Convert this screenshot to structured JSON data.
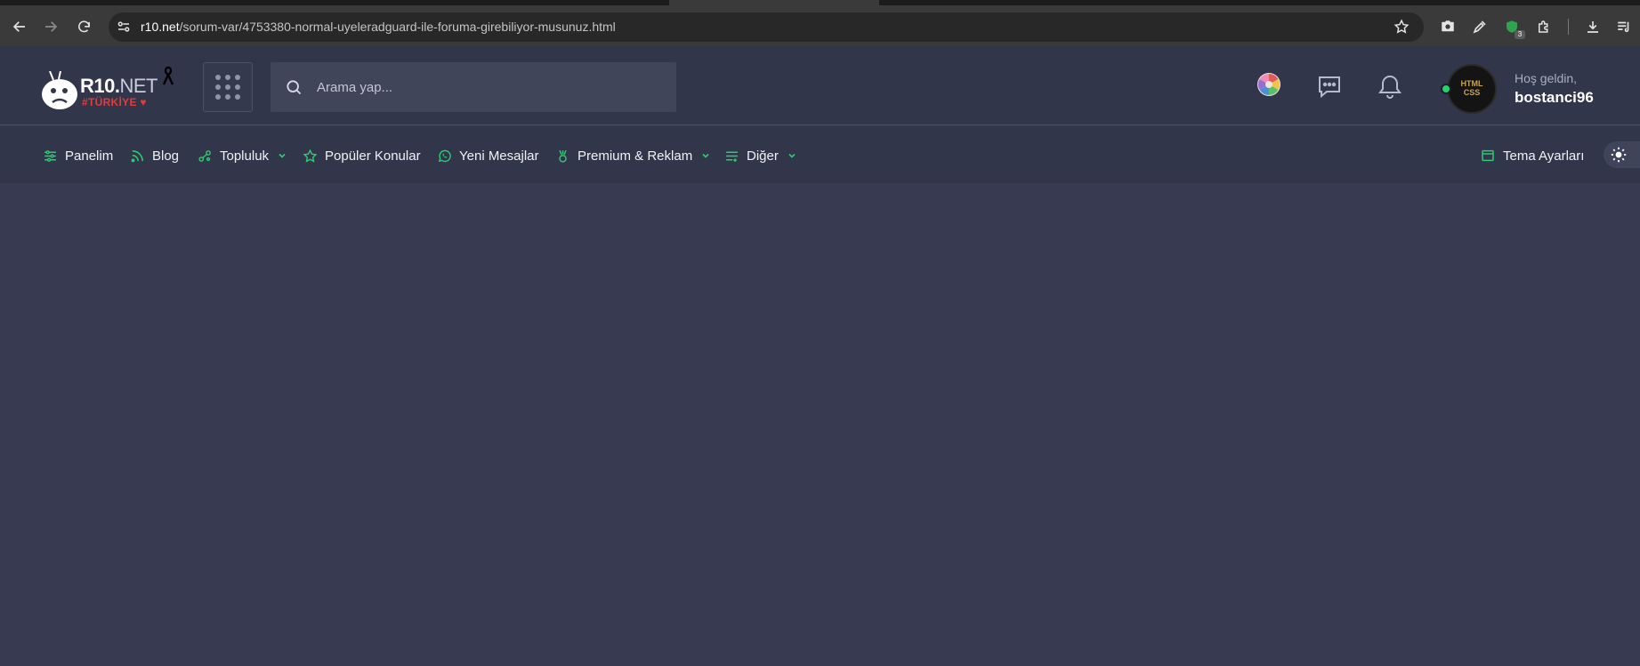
{
  "browser": {
    "url_host": "r10.net",
    "url_path": "/sorum-var/4753380-normal-uyeleradguard-ile-foruma-girebiliyor-musunuz.html",
    "extension_badge": "3"
  },
  "header": {
    "logo_name_bold": "R10.",
    "logo_name_light": "NET",
    "logo_sub": "#TÜRKİYE ♥",
    "search_placeholder": "Arama yap...",
    "greeting": "Hoş geldin,",
    "username": "bostanci96",
    "avatar_text_line1": "HTML",
    "avatar_text_line2": "CSS"
  },
  "nav": {
    "items": [
      {
        "label": "Panelim",
        "icon": "sliders-icon"
      },
      {
        "label": "Blog",
        "icon": "feed-icon"
      },
      {
        "label": "Topluluk",
        "icon": "community-icon",
        "dropdown": true
      },
      {
        "label": "Popüler Konular",
        "icon": "star-icon"
      },
      {
        "label": "Yeni Mesajlar",
        "icon": "whatsapp-icon"
      },
      {
        "label": "Premium & Reklam",
        "icon": "medal-icon",
        "dropdown": true
      },
      {
        "label": "Diğer",
        "icon": "list-icon",
        "dropdown": true
      }
    ],
    "theme_settings": "Tema Ayarları"
  },
  "colors": {
    "accent": "#2ecc71",
    "header_bg": "#32364a",
    "page_bg": "#373a50",
    "brand_red": "#e23b3b"
  }
}
